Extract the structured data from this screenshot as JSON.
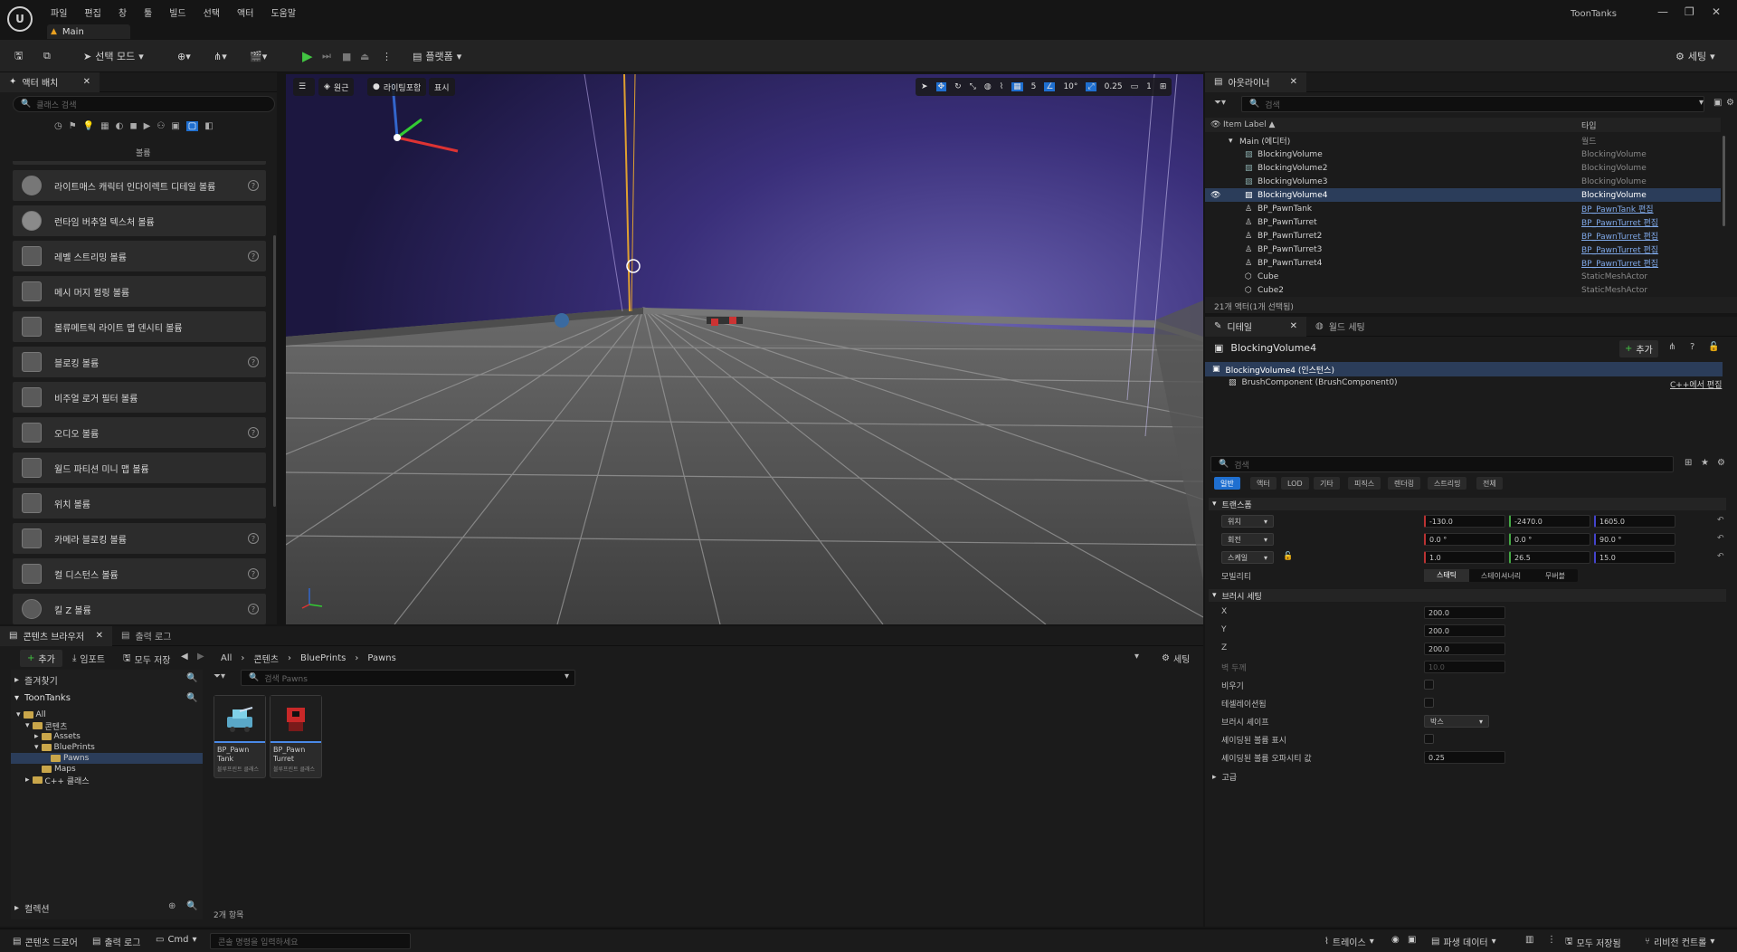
{
  "menu": {
    "items": [
      "파일",
      "편집",
      "창",
      "툴",
      "빌드",
      "선택",
      "액터",
      "도움말"
    ],
    "project_tab": "Main",
    "project_name": "ToonTanks"
  },
  "toolbar": {
    "save_label": "",
    "select_mode": "선택 모드",
    "platforms": "플랫폼",
    "settings": "세팅"
  },
  "place_actors": {
    "tab": "액터 배치",
    "search_placeholder": "클래스 검색",
    "category": "볼륨",
    "items": [
      {
        "label": "라이트매스 캐릭터 인다이렉트 디테일 볼륨",
        "help": true
      },
      {
        "label": "런타임 버추얼 텍스처 볼륨",
        "help": false
      },
      {
        "label": "레벨 스트리밍 볼륨",
        "help": true
      },
      {
        "label": "메시 머지 컬링 볼륨",
        "help": false
      },
      {
        "label": "볼류메트릭 라이트 맵 덴시티 볼륨",
        "help": false
      },
      {
        "label": "블로킹 볼륨",
        "help": true
      },
      {
        "label": "비주얼 로거 필터 볼륨",
        "help": false
      },
      {
        "label": "오디오 볼륨",
        "help": true
      },
      {
        "label": "월드 파티션 미니 맵 볼륨",
        "help": false
      },
      {
        "label": "위치 볼륨",
        "help": false
      },
      {
        "label": "카메라 블로킹 볼륨",
        "help": true
      },
      {
        "label": "컬 디스턴스 볼륨",
        "help": true
      },
      {
        "label": "킬 Z 볼륨",
        "help": true
      }
    ]
  },
  "viewport": {
    "perspective": "원근",
    "lit": "라이팅포함",
    "show": "표시",
    "grid": "5",
    "angle": "10°",
    "scale": "0.25",
    "camera": "1"
  },
  "outliner": {
    "tab": "아웃라이너",
    "search_placeholder": "검색",
    "col_label": "Item Label ▲",
    "col_type": "타입",
    "root": {
      "name": "Main (에디터)",
      "type": "월드"
    },
    "rows": [
      {
        "name": "BlockingVolume",
        "type": "BlockingVolume",
        "link": false,
        "selected": false
      },
      {
        "name": "BlockingVolume2",
        "type": "BlockingVolume",
        "link": false,
        "selected": false
      },
      {
        "name": "BlockingVolume3",
        "type": "BlockingVolume",
        "link": false,
        "selected": false
      },
      {
        "name": "BlockingVolume4",
        "type": "BlockingVolume",
        "link": false,
        "selected": true
      },
      {
        "name": "BP_PawnTank",
        "type": "BP_PawnTank 편집",
        "link": true,
        "selected": false
      },
      {
        "name": "BP_PawnTurret",
        "type": "BP_PawnTurret 편집",
        "link": true,
        "selected": false
      },
      {
        "name": "BP_PawnTurret2",
        "type": "BP_PawnTurret 편집",
        "link": true,
        "selected": false
      },
      {
        "name": "BP_PawnTurret3",
        "type": "BP_PawnTurret 편집",
        "link": true,
        "selected": false
      },
      {
        "name": "BP_PawnTurret4",
        "type": "BP_PawnTurret 편집",
        "link": true,
        "selected": false
      },
      {
        "name": "Cube",
        "type": "StaticMeshActor",
        "link": false,
        "selected": false
      },
      {
        "name": "Cube2",
        "type": "StaticMeshActor",
        "link": false,
        "selected": false
      }
    ],
    "footer": "21개 액터(1개 선택됨)"
  },
  "details": {
    "tab": "디테일",
    "tab2": "월드 세팅",
    "object": "BlockingVolume4",
    "add": "추가",
    "instance": "BlockingVolume4 (인스턴스)",
    "component": "BrushComponent (BrushComponent0)",
    "edit_cpp": "C++에서 편집",
    "search_placeholder": "검색",
    "categories": [
      "일반",
      "액터",
      "LOD",
      "기타",
      "피직스",
      "렌더링",
      "스트리밍",
      "전체"
    ],
    "transform_header": "트랜스폼",
    "location_label": "위치",
    "location": [
      "-130.0",
      "-2470.0",
      "1605.0"
    ],
    "rotation_label": "회전",
    "rotation": [
      "0.0 °",
      "0.0 °",
      "90.0 °"
    ],
    "scale_label": "스케일",
    "scale": [
      "1.0",
      "26.5",
      "15.0"
    ],
    "mobility_label": "모빌리티",
    "mobility": [
      "스태틱",
      "스테이셔너리",
      "무버블"
    ],
    "brush_header": "브러시 세팅",
    "x_label": "X",
    "x": "200.0",
    "y_label": "Y",
    "y": "200.0",
    "z_label": "Z",
    "z": "200.0",
    "wall_label": "벽 두께",
    "wall": "10.0",
    "hollow_label": "비우기",
    "tess_label": "테셀레이션됨",
    "shape_label": "브러시 셰이프",
    "shape": "박스",
    "shaded_label": "셰이딩된 볼륨 표시",
    "opacity_label": "셰이딩된 볼륨 오파시티 값",
    "opacity": "0.25",
    "advanced": "고급"
  },
  "content_browser": {
    "tab": "콘텐츠 브라우저",
    "tab2": "출력 로그",
    "add": "추가",
    "import": "임포트",
    "save_all": "모두 저장",
    "settings": "세팅",
    "path": [
      "All",
      "콘텐츠",
      "BluePrints",
      "Pawns"
    ],
    "favorites": "즐겨찾기",
    "project": "ToonTanks",
    "tree": [
      "All",
      "콘텐츠",
      "Assets",
      "BluePrints",
      "Pawns",
      "Maps",
      "C++ 클래스"
    ],
    "search_placeholder": "검색 Pawns",
    "assets": [
      {
        "name": "BP_Pawn Tank",
        "type": "블루프린트 클래스"
      },
      {
        "name": "BP_Pawn Turret",
        "type": "블루프린트 클래스"
      }
    ],
    "collections": "컬렉션",
    "count": "2개 항목"
  },
  "statusbar": {
    "drawer": "콘텐츠 드로어",
    "log": "출력 로그",
    "cmd": "Cmd",
    "cmd_placeholder": "콘솔 명령을 입력하세요",
    "trace": "트레이스",
    "derived": "파생 데이터",
    "save_all": "모두 저장됨",
    "revision": "리비전 컨트롤"
  },
  "colors": {
    "accent": "#1f6fd0",
    "selection": "#2b3d5a",
    "play": "#42c442",
    "viewport_sky": "#3a2f7a"
  }
}
